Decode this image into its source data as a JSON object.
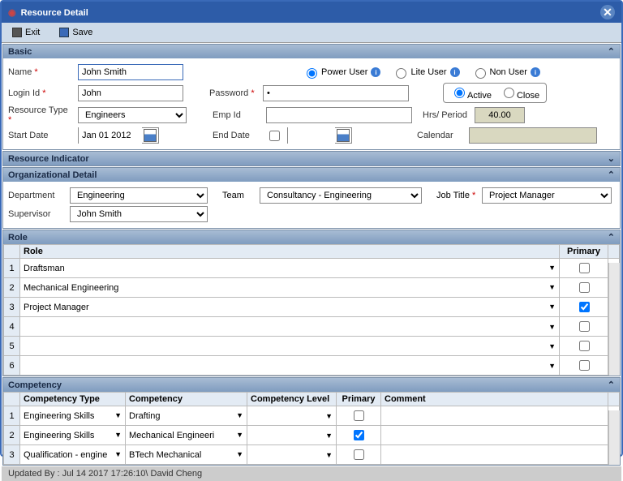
{
  "title": "Resource Detail",
  "toolbar": {
    "exit": "Exit",
    "save": "Save"
  },
  "basic": {
    "header": "Basic",
    "name_label": "Name",
    "name_value": "John Smith",
    "user_type": {
      "power": "Power User",
      "lite": "Lite User",
      "non": "Non User"
    },
    "login_label": "Login Id",
    "login_value": "John",
    "password_label": "Password",
    "password_value": "•",
    "status": {
      "active": "Active",
      "close": "Close"
    },
    "restype_label": "Resource Type",
    "restype_value": "Engineers",
    "empid_label": "Emp Id",
    "empid_value": "",
    "hrs_label": "Hrs/ Period",
    "hrs_value": "40.00",
    "start_label": "Start Date",
    "start_value": "Jan 01 2012",
    "end_label": "End Date",
    "end_value": "",
    "calendar_label": "Calendar",
    "calendar_value": ""
  },
  "indicator": {
    "header": "Resource Indicator"
  },
  "org": {
    "header": "Organizational Detail",
    "dept_label": "Department",
    "dept_value": "Engineering",
    "team_label": "Team",
    "team_value": "Consultancy - Engineering",
    "title_label": "Job Title",
    "title_value": "Project Manager",
    "sup_label": "Supervisor",
    "sup_value": "John Smith"
  },
  "role": {
    "header": "Role",
    "col_role": "Role",
    "col_primary": "Primary",
    "rows": [
      {
        "n": "1",
        "role": "Draftsman",
        "primary": false
      },
      {
        "n": "2",
        "role": "Mechanical Engineering",
        "primary": false
      },
      {
        "n": "3",
        "role": "Project Manager",
        "primary": true
      },
      {
        "n": "4",
        "role": "",
        "primary": false
      },
      {
        "n": "5",
        "role": "",
        "primary": false
      },
      {
        "n": "6",
        "role": "",
        "primary": false
      }
    ]
  },
  "comp": {
    "header": "Competency",
    "col_type": "Competency Type",
    "col_comp": "Competency",
    "col_level": "Competency Level",
    "col_primary": "Primary",
    "col_comment": "Comment",
    "rows": [
      {
        "n": "1",
        "type": "Engineering Skills",
        "comp": "Drafting",
        "level": "",
        "primary": false,
        "comment": ""
      },
      {
        "n": "2",
        "type": "Engineering Skills",
        "comp": "Mechanical Engineeri",
        "level": "",
        "primary": true,
        "comment": ""
      },
      {
        "n": "3",
        "type": "Qualification - engine",
        "comp": "BTech Mechanical",
        "level": "",
        "primary": false,
        "comment": ""
      }
    ]
  },
  "footer": "Updated By :  Jul 14 2017 17:26:10\\ David Cheng"
}
